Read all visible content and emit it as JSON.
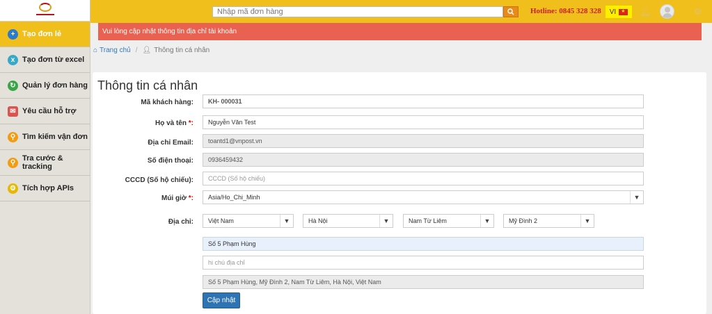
{
  "sidebar": {
    "items": [
      {
        "label": "Tạo đơn lẻ",
        "icon": "plus-circle-icon",
        "active": true
      },
      {
        "label": "Tạo đơn từ excel",
        "icon": "excel-icon"
      },
      {
        "label": "Quản lý đơn hàng",
        "icon": "refresh-icon"
      },
      {
        "label": "Yêu cầu hỗ trợ",
        "icon": "support-icon"
      },
      {
        "label": "Tìm kiếm vận đơn",
        "icon": "search-icon"
      },
      {
        "label": "Tra cước & tracking",
        "icon": "search-icon"
      },
      {
        "label": "Tích hợp APIs",
        "icon": "gear-icon"
      }
    ]
  },
  "header": {
    "search_placeholder": "Nhập mã đơn hàng",
    "hotline": "Hotline: 0845 328 328",
    "lang": "VI"
  },
  "alert": "Vui lòng cập nhật thông tin địa chỉ tài khoản",
  "breadcrumb": {
    "home": "Trang chủ",
    "current": "Thông tin cá nhân"
  },
  "form": {
    "title": "Thông tin cá nhân",
    "customer_code_label": "Mã khách hàng:",
    "customer_code": "KH- 000031",
    "fullname_label": "Họ và tên ",
    "fullname": "Nguyễn Văn Test",
    "email_label": "Địa chỉ Email:",
    "email": "toantd1@vnpost.vn",
    "phone_label": "Số điện thoại:",
    "phone": "0936459432",
    "id_label": "CCCD (Số hộ chiếu):",
    "id_placeholder": "CCCD (Số hộ chiếu)",
    "timezone_label": "Múi giờ ",
    "timezone": "Asia/Ho_Chi_Minh",
    "address_label": "Địa chỉ:",
    "country": "Việt Nam",
    "province": "Hà Nội",
    "district": "Nam Từ Liêm",
    "ward": "Mỹ Đình 2",
    "street": "Số 5 Phạm Hùng",
    "note_placeholder": "hi chú địa chỉ",
    "full_address": "Số 5 Phạm Hùng, Mỹ Đình 2, Nam Từ Liêm, Hà Nội, Việt Nam",
    "required_mark": "*:",
    "update_button": "Cập nhật"
  }
}
